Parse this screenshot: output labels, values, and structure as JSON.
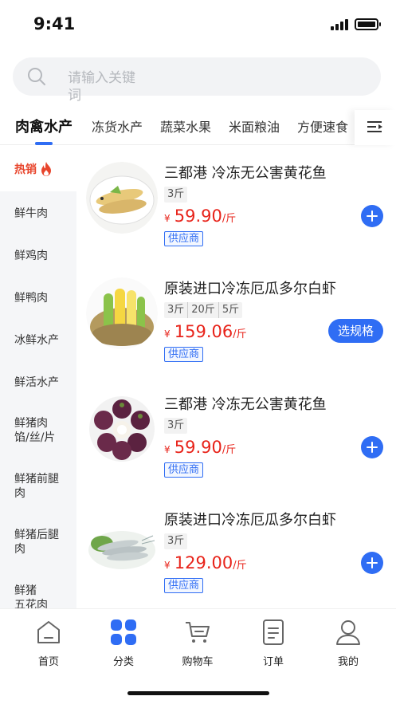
{
  "status_bar": {
    "time": "9:41"
  },
  "search": {
    "placeholder": "请输入关键词",
    "placeholder_line1": "请输入关键",
    "placeholder_line2": "词"
  },
  "categories": [
    "肉禽水产",
    "冻货水产",
    "蔬菜水果",
    "米面粮油",
    "方便速食"
  ],
  "sidebar": [
    "热销",
    "鲜牛肉",
    "鲜鸡肉",
    "鲜鸭肉",
    "冰鲜水产",
    "鲜活水产",
    "鲜猪肉馅/丝/片",
    "鲜猪前腿肉",
    "鲜猪后腿肉",
    "鲜猪五花肉"
  ],
  "sidebar_lines": {
    "pork_mince": [
      "鲜猪肉",
      "馅/丝/片"
    ],
    "pork_front": [
      "鲜猪前腿",
      "肉"
    ],
    "pork_back": [
      "鲜猪后腿",
      "肉"
    ],
    "pork_belly": [
      "鲜猪",
      "五花肉"
    ]
  },
  "products": [
    {
      "name": "三都港 冷冻无公害黄花鱼",
      "specs": [
        "3斤"
      ],
      "currency": "¥",
      "price": "59.90",
      "unit": "/斤",
      "supplier": "供应商",
      "action": "add"
    },
    {
      "name": "原装进口冷冻厄瓜多尔白虾",
      "specs": [
        "3斤",
        "20斤",
        "5斤"
      ],
      "currency": "¥",
      "price": "159.06",
      "unit": "/斤",
      "supplier": "供应商",
      "action": "选规格"
    },
    {
      "name": "三都港 冷冻无公害黄花鱼",
      "specs": [
        "3斤"
      ],
      "currency": "¥",
      "price": "59.90",
      "unit": "/斤",
      "supplier": "供应商",
      "action": "add"
    },
    {
      "name": "原装进口冷冻厄瓜多尔白虾",
      "specs": [
        "3斤"
      ],
      "currency": "¥",
      "price": "129.00",
      "unit": "/斤",
      "supplier": "供应商",
      "action": "add"
    }
  ],
  "tabbar": [
    "首页",
    "分类",
    "购物车",
    "订单",
    "我的"
  ],
  "colors": {
    "accent": "#2f6df4",
    "price": "#e8231a",
    "hot": "#e8452c"
  }
}
